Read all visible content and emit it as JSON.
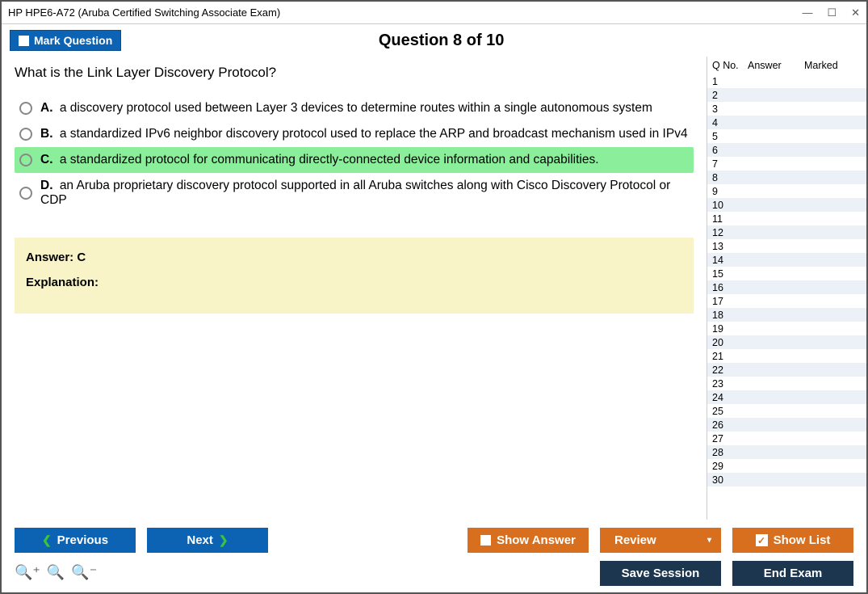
{
  "window": {
    "title": "HP HPE6-A72 (Aruba Certified Switching Associate Exam)"
  },
  "header": {
    "mark_label": "Mark Question",
    "question_title": "Question 8 of 10"
  },
  "question": {
    "text": "What is the Link Layer Discovery Protocol?",
    "options": {
      "A": {
        "letter": "A.",
        "text": "a discovery protocol used between Layer 3 devices to determine routes within a single autonomous system"
      },
      "B": {
        "letter": "B.",
        "text": "a standardized IPv6 neighbor discovery protocol used to replace the ARP and broadcast mechanism used in IPv4"
      },
      "C": {
        "letter": "C.",
        "text": "a standardized protocol for communicating directly-connected device information and capabilities."
      },
      "D": {
        "letter": "D.",
        "text": "an Aruba proprietary discovery protocol supported in all Aruba switches along with Cisco Discovery Protocol or CDP"
      }
    },
    "answer_label": "Answer: C",
    "explanation_label": "Explanation:"
  },
  "sidebar": {
    "col_qno": "Q No.",
    "col_answer": "Answer",
    "col_marked": "Marked",
    "row_count": 30
  },
  "footer": {
    "previous": "Previous",
    "next": "Next",
    "show_answer": "Show Answer",
    "review": "Review",
    "show_list": "Show List",
    "save_session": "Save Session",
    "end_exam": "End Exam"
  }
}
